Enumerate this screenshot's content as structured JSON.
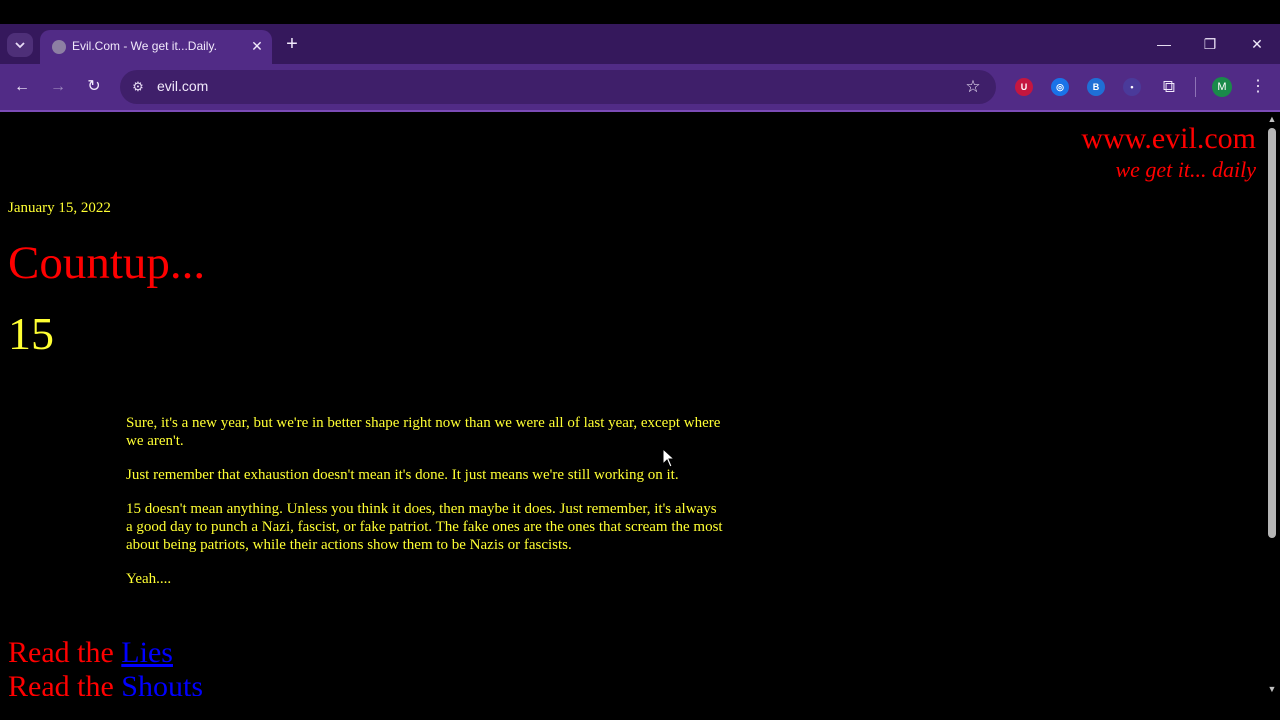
{
  "browser": {
    "tab_search_icon": "chevron-down",
    "tab_title": "Evil.Com - We get it...Daily.",
    "tab_close": "✕",
    "new_tab": "+",
    "minimize": "—",
    "restore": "❐",
    "close": "✕",
    "back": "←",
    "forward": "→",
    "reload": "↻",
    "url": "evil.com",
    "star": "☆",
    "extensions": [
      {
        "name": "ublock-icon",
        "label": "U",
        "color": "#c4163f"
      },
      {
        "name": "extension-icon-2",
        "label": "◎",
        "color": "#1a73e8"
      },
      {
        "name": "extension-icon-3",
        "label": "B",
        "color": "#1f6fd6"
      },
      {
        "name": "extension-icon-4",
        "label": "•",
        "color": "#4a3a9a"
      }
    ],
    "puzzle": "⧉",
    "avatar_letter": "M",
    "menu": "⋮"
  },
  "page": {
    "site_title": "www.evil.com",
    "site_tagline": "we get it... daily",
    "date": "January 15, 2022",
    "title": "Countup...",
    "number": "15",
    "paragraphs": [
      "Sure, it's a new year, but we're in better shape right now than we were all of last year, except where we aren't.",
      "Just remember that exhaustion doesn't mean it's done. It just means we're still working on it.",
      "15 doesn't mean anything. Unless you think it does, then maybe it does. Just remember, it's always a good day to punch a Nazi, fascist, or fake patriot. The fake ones are the ones that scream the most about being patriots, while their actions show them to be Nazis or fascists.",
      "Yeah...."
    ],
    "read_prefix": "Read the",
    "link_lies": "Lies",
    "link_shouts": "Shouts"
  },
  "colors": {
    "accent_red": "#ff0000",
    "text_yellow": "#ffff33",
    "link_blue": "#0000ff",
    "chrome_purple": "#512b86"
  }
}
